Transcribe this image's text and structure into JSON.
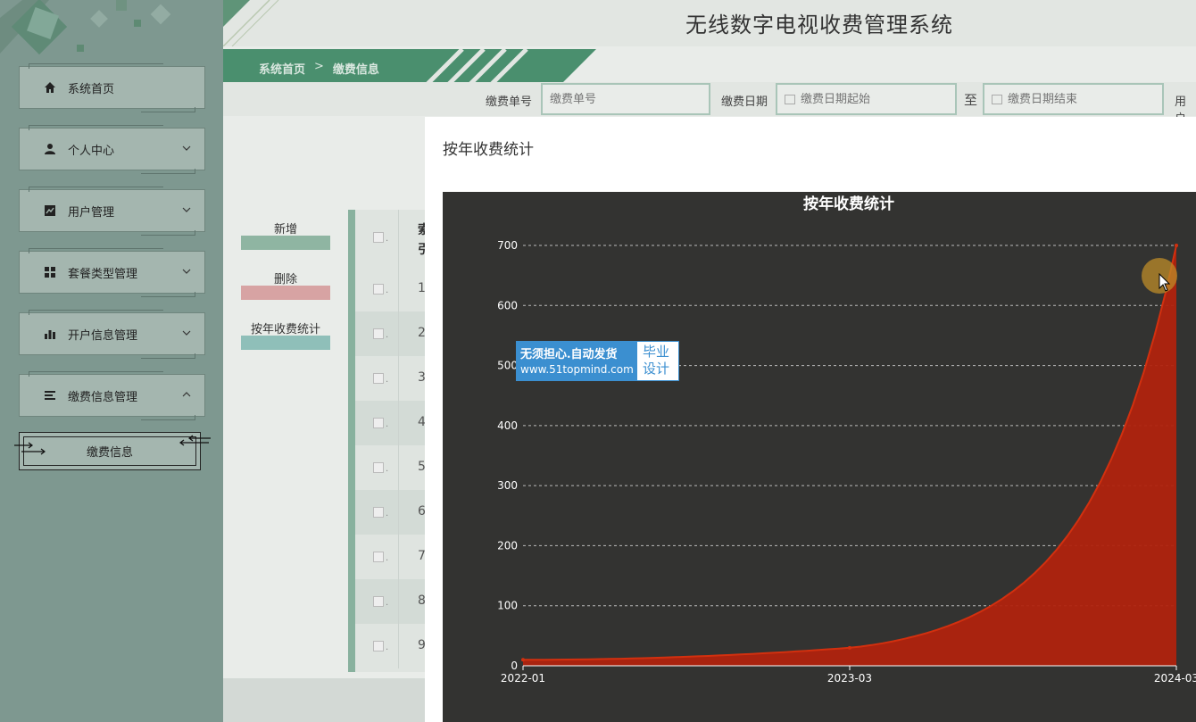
{
  "app": {
    "title": "无线数字电视收费管理系统"
  },
  "breadcrumb": {
    "home": "系统首页",
    "separator": ">",
    "current": "缴费信息"
  },
  "sidebar": {
    "items": [
      {
        "label": "系统首页",
        "icon": "home-icon"
      },
      {
        "label": "个人中心",
        "icon": "person-icon",
        "expandable": true
      },
      {
        "label": "用户管理",
        "icon": "chart-line-icon",
        "expandable": true
      },
      {
        "label": "套餐类型管理",
        "icon": "grid-icon",
        "expandable": true
      },
      {
        "label": "开户信息管理",
        "icon": "bar-chart-icon",
        "expandable": true
      },
      {
        "label": "缴费信息管理",
        "icon": "list-icon",
        "expandable": true,
        "expanded": true
      }
    ],
    "submenu": {
      "label": "缴费信息"
    }
  },
  "search": {
    "order_label": "缴费单号",
    "order_placeholder": "缴费单号",
    "date_label": "缴费日期",
    "date_start_placeholder": "缴费日期起始",
    "to_label": "至",
    "date_end_placeholder": "缴费日期结束",
    "user_label": "用户"
  },
  "actions": {
    "add": "新增",
    "delete": "删除",
    "yearly_stats": "按年收费统计"
  },
  "table": {
    "header_partial": [
      "索",
      "引"
    ],
    "row_numbers": [
      "1",
      "2",
      "3",
      "4",
      "5",
      "6",
      "7",
      "8",
      "9"
    ],
    "checkbox_suffix": "."
  },
  "modal": {
    "title": "按年收费统计"
  },
  "watermark": {
    "line1": "无须担心.自动发货",
    "line2": "www.51topmind.com",
    "right_line1": "毕业",
    "right_line2": "设计"
  },
  "colors": {
    "accent": "#4a8f6e",
    "area_fill": "#b0230e",
    "chart_bg": "#333331",
    "add_bar": "#8fb5a2",
    "delete_bar": "#d7a3a3",
    "stats_bar": "#8fbfb9"
  },
  "chart_data": {
    "type": "area",
    "title": "按年收费统计",
    "x": [
      "2022-01",
      "2023-03",
      "2024-03"
    ],
    "x_ticks": [
      "2022-01",
      "2023-03",
      "2024-03"
    ],
    "series": [
      {
        "values": [
          10,
          30,
          700
        ]
      }
    ],
    "ylim": [
      0,
      700
    ],
    "y_ticks": [
      0,
      100,
      200,
      300,
      400,
      500,
      600,
      700
    ],
    "grid": true,
    "smooth": true
  }
}
